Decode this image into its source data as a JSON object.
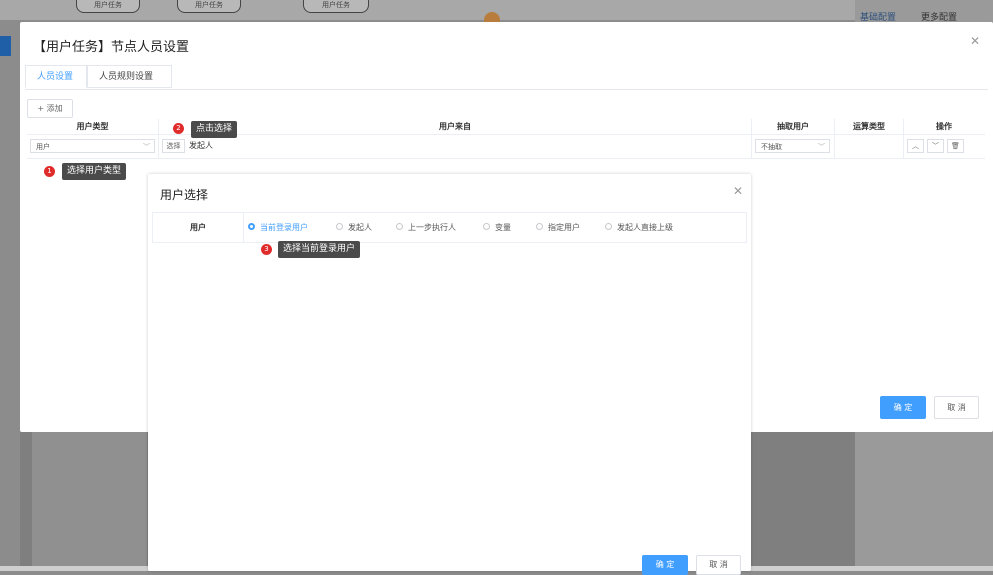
{
  "background": {
    "pills": [
      "用户任务",
      "用户任务",
      "用户任务"
    ],
    "links": [
      "基础配置",
      "更多配置"
    ]
  },
  "dialog1": {
    "title": "【用户任务】节点人员设置",
    "tabs": [
      "人员设置",
      "人员规则设置"
    ],
    "add_label": "+ 添加",
    "columns": [
      "用户类型",
      "用户来自",
      "抽取用户",
      "运算类型",
      "操作"
    ],
    "row": {
      "user_type": "用户",
      "select_button": "选择",
      "user_from": "发起人",
      "extract": "不抽取"
    },
    "ok_label": "确 定",
    "cancel_label": "取 消"
  },
  "dialog2": {
    "title": "用户选择",
    "row_label": "用户",
    "options": [
      "当前登录用户",
      "发起人",
      "上一步执行人",
      "变量",
      "指定用户",
      "发起人直接上级"
    ],
    "selected": "当前登录用户",
    "ok_label": "确 定",
    "cancel_label": "取 消"
  },
  "annotations": [
    {
      "badge": "1",
      "text": "选择用户类型"
    },
    {
      "badge": "2",
      "text": "点击选择"
    },
    {
      "badge": "3",
      "text": "选择当前登录用户"
    }
  ],
  "colors": {
    "accent": "#409eff",
    "badge": "#e02b2b",
    "tooltip": "#4a4a4a"
  }
}
